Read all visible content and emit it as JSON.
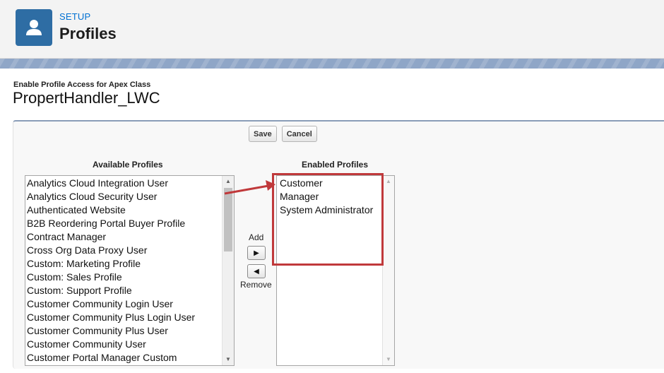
{
  "header": {
    "section": "SETUP",
    "title": "Profiles",
    "icon": "user-icon",
    "icon_color": "#2e6da4"
  },
  "page": {
    "subtitle": "Enable Profile Access for Apex Class",
    "class_name": "PropertHandler_LWC"
  },
  "toolbar": {
    "save_label": "Save",
    "cancel_label": "Cancel"
  },
  "available": {
    "label": "Available Profiles",
    "items": [
      "Analytics Cloud Integration User",
      "Analytics Cloud Security User",
      "Authenticated Website",
      "B2B Reordering Portal Buyer Profile",
      "Contract Manager",
      "Cross Org Data Proxy User",
      "Custom: Marketing Profile",
      "Custom: Sales Profile",
      "Custom: Support Profile",
      "Customer Community Login User",
      "Customer Community Plus Login User",
      "Customer Community Plus User",
      "Customer Community User",
      "Customer Portal Manager Custom"
    ]
  },
  "enabled": {
    "label": "Enabled Profiles",
    "items": [
      "Customer",
      "Manager",
      "System Administrator"
    ]
  },
  "move": {
    "add_label": "Add",
    "remove_label": "Remove"
  },
  "annotation": {
    "highlight_color": "#c0393b"
  }
}
